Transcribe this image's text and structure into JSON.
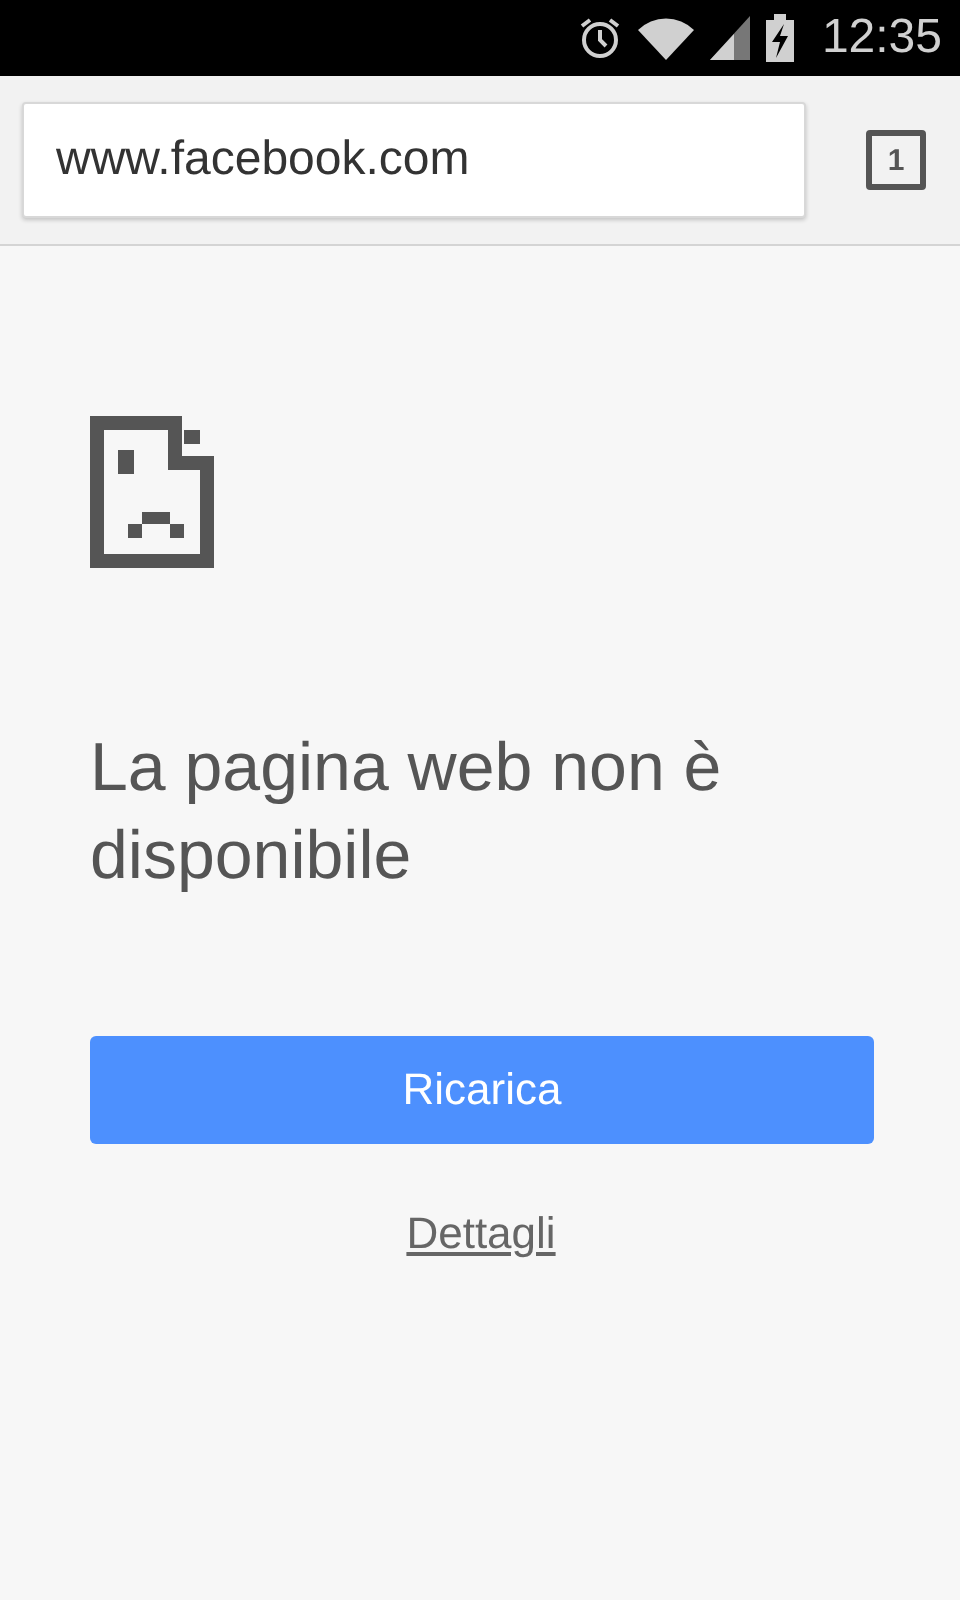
{
  "status_bar": {
    "time": "12:35"
  },
  "toolbar": {
    "url": "www.facebook.com",
    "tab_count": "1"
  },
  "error": {
    "title": "La pagina web non è disponibile",
    "reload_button": "Ricarica",
    "details_link": "Dettagli"
  }
}
